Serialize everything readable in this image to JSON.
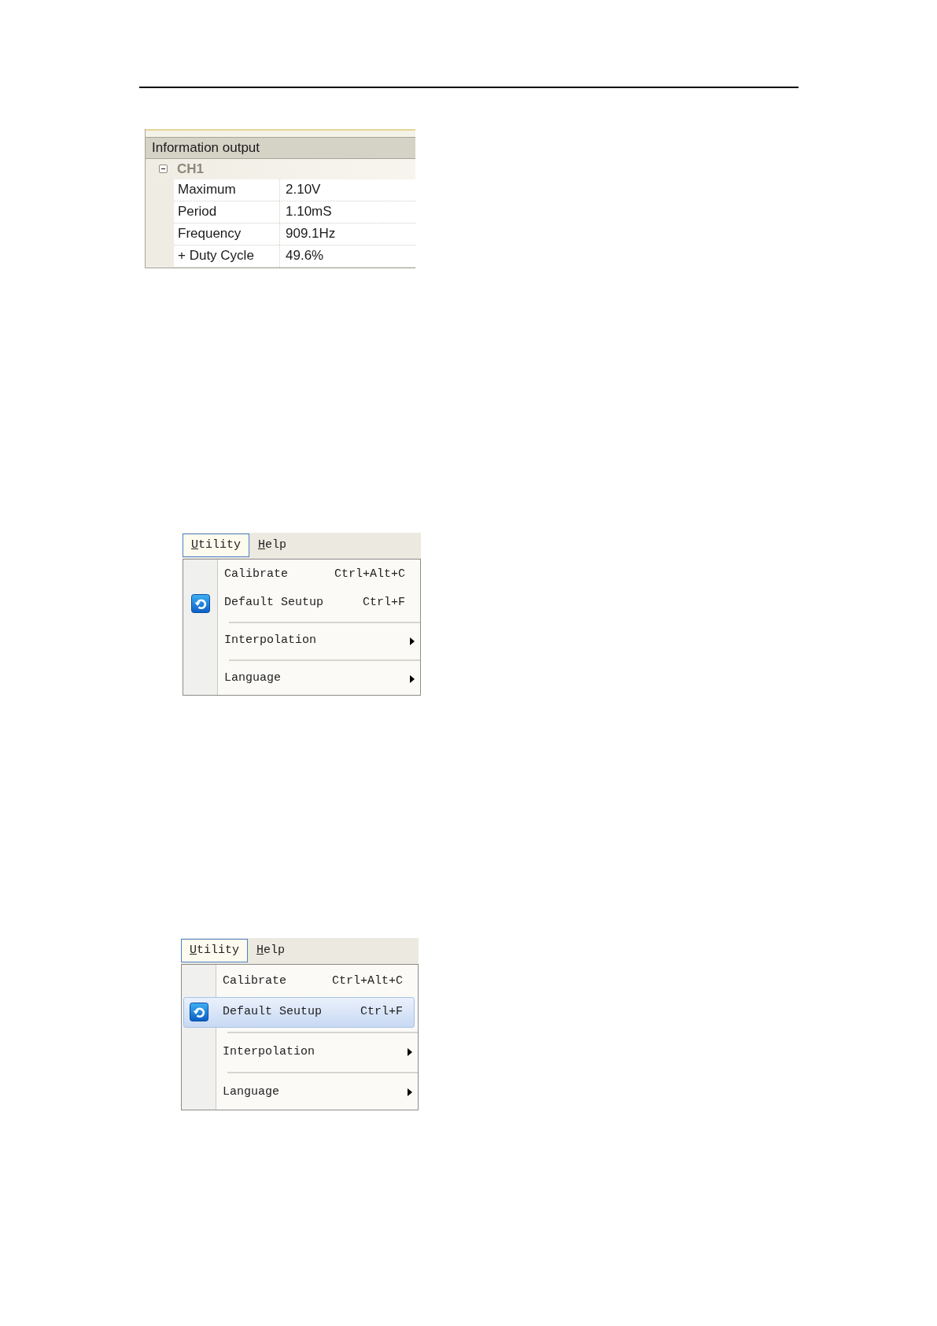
{
  "info_panel": {
    "title": "Information output",
    "groups": [
      {
        "label": "CH1",
        "expanded": true,
        "rows": [
          {
            "name": "Maximum",
            "value": "2.10V"
          },
          {
            "name": "Period",
            "value": "1.10mS"
          },
          {
            "name": "Frequency",
            "value": "909.1Hz"
          },
          {
            "name": "+ Duty Cycle",
            "value": "49.6%"
          }
        ]
      }
    ]
  },
  "menus": [
    {
      "menu_bar": [
        {
          "label": "Utility",
          "access_key_underlined": true,
          "selected": true
        },
        {
          "label": "Help",
          "access_key_underlined": true,
          "selected": false
        }
      ],
      "items": [
        {
          "kind": "command",
          "label": "Calibrate",
          "shortcut": "Ctrl+Alt+C",
          "icon": false,
          "selected": false
        },
        {
          "kind": "command",
          "label": "Default Seutup",
          "shortcut": "Ctrl+F",
          "icon": true,
          "selected": false
        },
        {
          "kind": "separator"
        },
        {
          "kind": "submenu",
          "label": "Interpolation",
          "selected": false
        },
        {
          "kind": "separator"
        },
        {
          "kind": "submenu",
          "label": "Language",
          "selected": false
        }
      ]
    },
    {
      "menu_bar": [
        {
          "label": "Utility",
          "access_key_underlined": true,
          "selected": true
        },
        {
          "label": "Help",
          "access_key_underlined": true,
          "selected": false
        }
      ],
      "items": [
        {
          "kind": "command",
          "label": "Calibrate",
          "shortcut": "Ctrl+Alt+C",
          "icon": false,
          "selected": false
        },
        {
          "kind": "command",
          "label": "Default Seutup",
          "shortcut": "Ctrl+F",
          "icon": true,
          "selected": true
        },
        {
          "kind": "separator"
        },
        {
          "kind": "submenu",
          "label": "Interpolation",
          "selected": false
        },
        {
          "kind": "separator"
        },
        {
          "kind": "submenu",
          "label": "Language",
          "selected": false
        }
      ]
    }
  ]
}
